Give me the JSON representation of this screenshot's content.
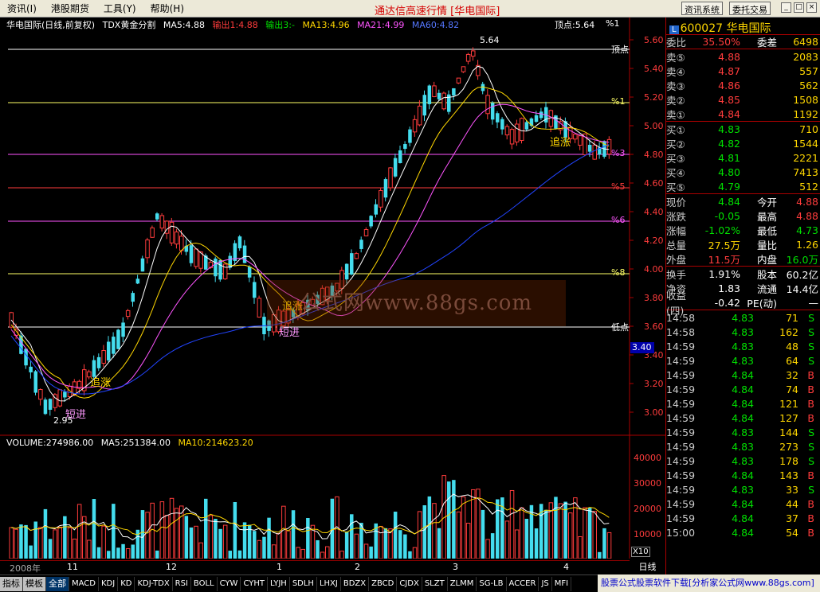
{
  "menu": {
    "items": [
      "资讯(I)",
      "港股期货",
      "工具(Y)",
      "帮助(H)"
    ],
    "title": "通达信高速行情 [华电国际]",
    "btn_info": "资讯系统",
    "btn_trade": "委托交易"
  },
  "chart": {
    "header": {
      "name": "华电国际(日线,前复权)",
      "indicator": "TDX黄金分割",
      "ma5": "MA5:4.88",
      "out1": "输出1:4.88",
      "out3": "输出3:-",
      "ma13": "MA13:4.96",
      "ma21": "MA21:4.99",
      "ma60": "MA60:4.82",
      "top": "顶点:5.64",
      "pct": "%1"
    },
    "price_axis": [
      "5.60",
      "5.40",
      "5.20",
      "5.00",
      "4.80",
      "4.60",
      "4.40",
      "4.20",
      "4.00",
      "3.80",
      "3.60",
      "3.40",
      "3.20",
      "3.00"
    ],
    "current_price_tag": "3.40",
    "level_labels": [
      "顶点",
      "%1",
      "%3",
      "%5",
      "%6",
      "%8",
      "低点"
    ],
    "annotations": {
      "high": "5.64",
      "low": "2.95",
      "chase1": "追涨",
      "chase2": "追涨",
      "chase3": "追涨",
      "short1": "短进",
      "short2": "短进"
    },
    "volume_header": {
      "vol": "VOLUME:274986.00",
      "ma5": "MA5:251384.00",
      "ma10": "MA10:214623.20"
    },
    "volume_axis": [
      "40000",
      "30000",
      "20000",
      "10000"
    ],
    "vol_unit": "X10",
    "dates": [
      "2008年",
      "11",
      "12",
      "1",
      "2",
      "3",
      "4"
    ],
    "period": "日线",
    "watermark": "公式网www.88gs.com"
  },
  "quote": {
    "code": "600027",
    "name": "华电国际",
    "badge": "L",
    "weibi_label": "委比",
    "weibi": "35.50%",
    "weicha_label": "委差",
    "weicha": "6498",
    "sell": [
      {
        "label": "卖⑤",
        "price": "4.88",
        "vol": "2083"
      },
      {
        "label": "卖④",
        "price": "4.87",
        "vol": "557"
      },
      {
        "label": "卖③",
        "price": "4.86",
        "vol": "562"
      },
      {
        "label": "卖②",
        "price": "4.85",
        "vol": "1508"
      },
      {
        "label": "卖①",
        "price": "4.84",
        "vol": "1192"
      }
    ],
    "buy": [
      {
        "label": "买①",
        "price": "4.83",
        "vol": "710"
      },
      {
        "label": "买②",
        "price": "4.82",
        "vol": "1544"
      },
      {
        "label": "买③",
        "price": "4.81",
        "vol": "2221"
      },
      {
        "label": "买④",
        "price": "4.80",
        "vol": "7413"
      },
      {
        "label": "买⑤",
        "price": "4.79",
        "vol": "512"
      }
    ],
    "stats": [
      {
        "l1": "现价",
        "v1": "4.84",
        "c1": "dn",
        "l2": "今开",
        "v2": "4.88",
        "c2": "up"
      },
      {
        "l1": "涨跌",
        "v1": "-0.05",
        "c1": "dn",
        "l2": "最高",
        "v2": "4.88",
        "c2": "up"
      },
      {
        "l1": "涨幅",
        "v1": "-1.02%",
        "c1": "dn",
        "l2": "最低",
        "v2": "4.73",
        "c2": "dn"
      },
      {
        "l1": "总量",
        "v1": "27.5万",
        "c1": "ye",
        "l2": "量比",
        "v2": "1.26",
        "c2": "ye"
      },
      {
        "l1": "外盘",
        "v1": "11.5万",
        "c1": "up",
        "l2": "内盘",
        "v2": "16.0万",
        "c2": "dn"
      }
    ],
    "stats2": [
      {
        "l1": "换手",
        "v1": "1.91%",
        "l2": "股本",
        "v2": "60.2亿"
      },
      {
        "l1": "净资",
        "v1": "1.83",
        "l2": "流通",
        "v2": "14.4亿"
      },
      {
        "l1": "收益(四)",
        "v1": "-0.42",
        "l2": "PE(动)",
        "v2": "—"
      }
    ],
    "ticks": [
      {
        "t": "14:58",
        "p": "4.83",
        "v": "71",
        "s": "S"
      },
      {
        "t": "14:58",
        "p": "4.83",
        "v": "162",
        "s": "S"
      },
      {
        "t": "14:59",
        "p": "4.83",
        "v": "48",
        "s": "S"
      },
      {
        "t": "14:59",
        "p": "4.83",
        "v": "64",
        "s": "S"
      },
      {
        "t": "14:59",
        "p": "4.84",
        "v": "32",
        "s": "B"
      },
      {
        "t": "14:59",
        "p": "4.84",
        "v": "74",
        "s": "B"
      },
      {
        "t": "14:59",
        "p": "4.84",
        "v": "121",
        "s": "B"
      },
      {
        "t": "14:59",
        "p": "4.84",
        "v": "127",
        "s": "B"
      },
      {
        "t": "14:59",
        "p": "4.83",
        "v": "144",
        "s": "S"
      },
      {
        "t": "14:59",
        "p": "4.83",
        "v": "273",
        "s": "S"
      },
      {
        "t": "14:59",
        "p": "4.83",
        "v": "178",
        "s": "S"
      },
      {
        "t": "14:59",
        "p": "4.84",
        "v": "143",
        "s": "B"
      },
      {
        "t": "14:59",
        "p": "4.83",
        "v": "33",
        "s": "S"
      },
      {
        "t": "14:59",
        "p": "4.84",
        "v": "44",
        "s": "B"
      },
      {
        "t": "14:59",
        "p": "4.84",
        "v": "37",
        "s": "B"
      },
      {
        "t": "15:00",
        "p": "4.84",
        "v": "54",
        "s": "B"
      }
    ]
  },
  "tabs": [
    "指标",
    "模板",
    "全部",
    "MACD",
    "KDJ",
    "KD",
    "KDJ-TDX",
    "RSI",
    "BOLL",
    "CYW",
    "CYHT",
    "LYJH",
    "SDLH",
    "LHXJ",
    "BDZX",
    "ZBCD",
    "CJDX",
    "SLZT",
    "ZLMM",
    "SG-LB",
    "ACCER",
    "JS",
    "MFI"
  ],
  "ad": "股票公式股票软件下载[分析家公式网www.88gs.com]"
}
